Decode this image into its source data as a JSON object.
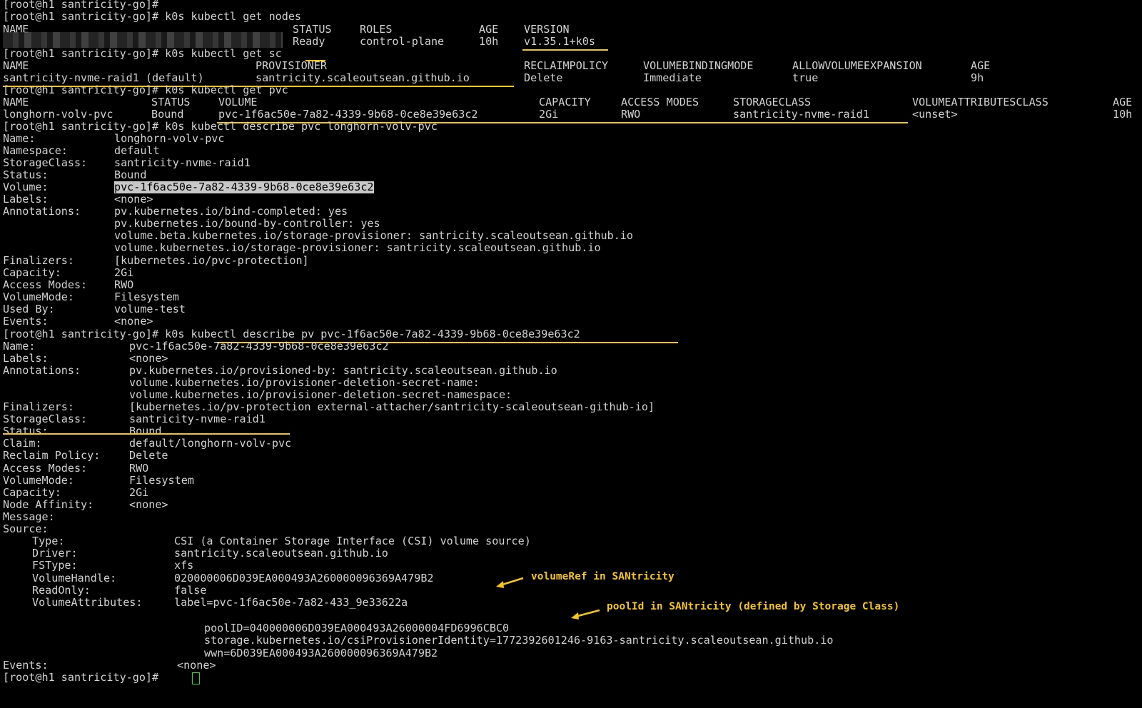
{
  "terminal": {
    "prompt_end": "[root@h1 santricity-go]#",
    "cmd_get_nodes": "[root@h1 santricity-go]# k0s kubectl get nodes",
    "cmd_get_sc": "[root@h1 santricity-go]# k0s kubectl get sc",
    "cmd_get_pvc": "[root@h1 santricity-go]# k0s kubectl get pvc",
    "cmd_describe_pvc": "[root@h1 santricity-go]# k0s kubectl describe pvc longhorn-volv-pvc",
    "cmd_describe_pv": "[root@h1 santricity-go]# k0s kubectl describe pv pvc-1f6ac50e-7a82-4339-9b68-0ce8e39e63c2",
    "final_prompt": "[root@h1 santricity-go]#"
  },
  "nodes": {
    "headers": [
      "NAME",
      "STATUS",
      "ROLES",
      "AGE",
      "VERSION"
    ],
    "row": [
      "Ready",
      "control-plane",
      "10h",
      "v1.35.1+k0s"
    ]
  },
  "sc": {
    "headers": [
      "NAME",
      "PROVISIONER",
      "RECLAIMPOLICY",
      "VOLUMEBINDINGMODE",
      "ALLOWVOLUMEEXPANSION",
      "AGE"
    ],
    "row": [
      "santricity-nvme-raid1 (default)",
      "santricity.scaleoutsean.github.io",
      "Delete",
      "Immediate",
      "true",
      "9h"
    ]
  },
  "pvc_list": {
    "headers": [
      "NAME",
      "STATUS",
      "VOLUME",
      "CAPACITY",
      "ACCESS MODES",
      "STORAGECLASS",
      "VOLUMEATTRIBUTESCLASS",
      "AGE"
    ],
    "row": [
      "longhorn-volv-pvc",
      "Bound",
      "pvc-1f6ac50e-7a82-4339-9b68-0ce8e39e63c2",
      "2Gi",
      "RWO",
      "santricity-nvme-raid1",
      "<unset>",
      "10h"
    ]
  },
  "pvc_describe": [
    {
      "key": "Name:",
      "val": "longhorn-volv-pvc"
    },
    {
      "key": "Namespace:",
      "val": "default"
    },
    {
      "key": "StorageClass:",
      "val": "santricity-nvme-raid1"
    },
    {
      "key": "Status:",
      "val": "Bound"
    },
    {
      "key": "Volume:",
      "val": "pvc-1f6ac50e-7a82-4339-9b68-0ce8e39e63c2"
    },
    {
      "key": "Labels:",
      "val": "<none>"
    },
    {
      "key": "Annotations:",
      "val": "pv.kubernetes.io/bind-completed: yes"
    },
    {
      "key": "",
      "val": "pv.kubernetes.io/bound-by-controller: yes"
    },
    {
      "key": "",
      "val": "volume.beta.kubernetes.io/storage-provisioner: santricity.scaleoutsean.github.io"
    },
    {
      "key": "",
      "val": "volume.kubernetes.io/storage-provisioner: santricity.scaleoutsean.github.io"
    },
    {
      "key": "Finalizers:",
      "val": "[kubernetes.io/pvc-protection]"
    },
    {
      "key": "Capacity:",
      "val": "2Gi"
    },
    {
      "key": "Access Modes:",
      "val": "RWO"
    },
    {
      "key": "VolumeMode:",
      "val": "Filesystem"
    },
    {
      "key": "Used By:",
      "val": "volume-test"
    },
    {
      "key": "Events:",
      "val": "<none>"
    }
  ],
  "pv_describe": [
    {
      "key": "Name:",
      "val": "pvc-1f6ac50e-7a82-4339-9b68-0ce8e39e63c2"
    },
    {
      "key": "Labels:",
      "val": "<none>"
    },
    {
      "key": "Annotations:",
      "val": "pv.kubernetes.io/provisioned-by: santricity.scaleoutsean.github.io"
    },
    {
      "key": "",
      "val": "volume.kubernetes.io/provisioner-deletion-secret-name:"
    },
    {
      "key": "",
      "val": "volume.kubernetes.io/provisioner-deletion-secret-namespace:"
    },
    {
      "key": "Finalizers:",
      "val": "[kubernetes.io/pv-protection external-attacher/santricity-scaleoutsean-github-io]"
    },
    {
      "key": "StorageClass:",
      "val": "santricity-nvme-raid1"
    },
    {
      "key": "Status:",
      "val": "Bound"
    },
    {
      "key": "Claim:",
      "val": "default/longhorn-volv-pvc"
    },
    {
      "key": "Reclaim Policy:",
      "val": "Delete"
    },
    {
      "key": "Access Modes:",
      "val": "RWO"
    },
    {
      "key": "VolumeMode:",
      "val": "Filesystem"
    },
    {
      "key": "Capacity:",
      "val": "2Gi"
    },
    {
      "key": "Node Affinity:",
      "val": "<none>"
    },
    {
      "key": "Message:",
      "val": ""
    },
    {
      "key": "Source:",
      "val": ""
    }
  ],
  "source": [
    {
      "key": "Type:",
      "val": "CSI (a Container Storage Interface (CSI) volume source)"
    },
    {
      "key": "Driver:",
      "val": "santricity.scaleoutsean.github.io"
    },
    {
      "key": "FSType:",
      "val": "xfs"
    },
    {
      "key": "VolumeHandle:",
      "val": "020000006D039EA000493A260000096369A479B2"
    },
    {
      "key": "ReadOnly:",
      "val": "false"
    },
    {
      "key": "VolumeAttributes:",
      "val": "label=pvc-1f6ac50e-7a82-433_9e33622a"
    }
  ],
  "volume_attributes_more": [
    "poolID=040000006D039EA000493A26000004FD6996CBC0",
    "storage.kubernetes.io/csiProvisionerIdentity=1772392601246-9163-santricity.scaleoutsean.github.io",
    "wwn=6D039EA000493A260000096369A479B2"
  ],
  "source_events": {
    "key": "Events:",
    "val": "<none>"
  },
  "annotations": {
    "volume_ref": "volumeRef in SANtricity",
    "pool_id": "poolId in SANtricity (defined by Storage Class)"
  },
  "colors": {
    "background": "#000000",
    "text": "#d2d2d2",
    "highlight": "#f5c518",
    "cursor": "#22e022"
  }
}
